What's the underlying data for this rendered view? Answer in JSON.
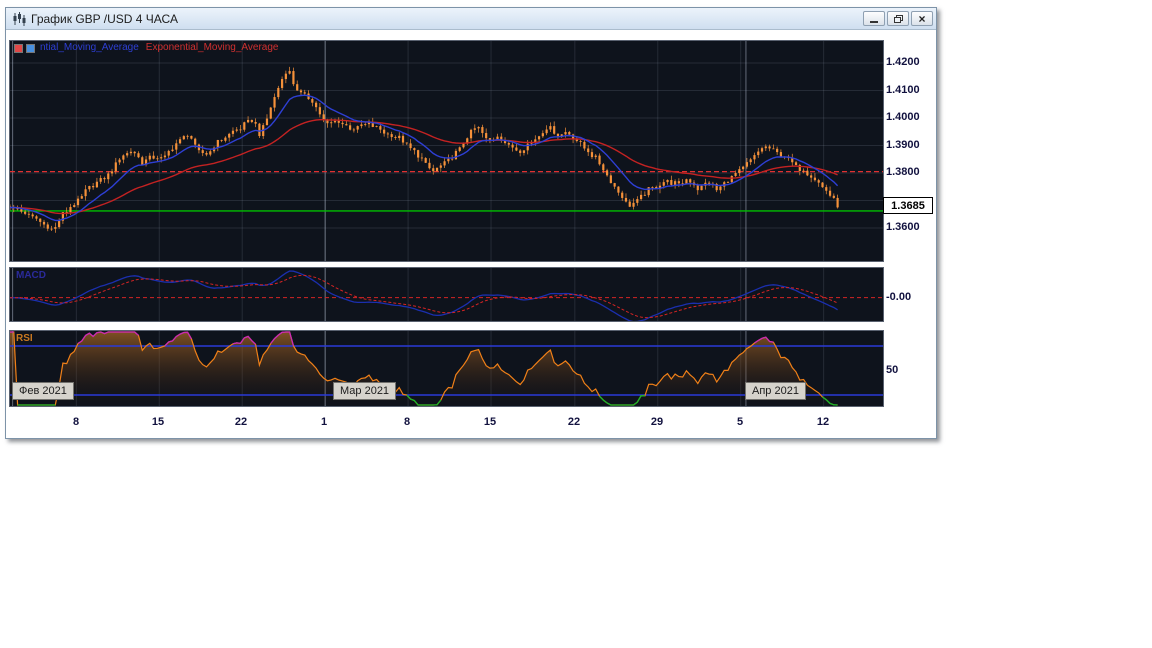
{
  "window": {
    "title": "График GBP /USD  4 ЧАСА",
    "close_glyph": "×"
  },
  "legend": {
    "blue_label": "ntial_Moving_Average",
    "red_label": "Exponential_Moving_Average"
  },
  "panels": {
    "macd_label": "MACD",
    "rsi_label": "RSI"
  },
  "price_axis": {
    "labels": [
      "1.4200",
      "1.4100",
      "1.4000",
      "1.3900",
      "1.3800",
      "1.3600"
    ],
    "current_price": "1.3685"
  },
  "macd_axis": {
    "zero_label": "-0.00"
  },
  "rsi_axis": {
    "mid_label": "50"
  },
  "time_axis": {
    "ticks": [
      "8",
      "15",
      "22",
      "1",
      "8",
      "15",
      "22",
      "29",
      "5",
      "12"
    ],
    "months": [
      "Фев 2021",
      "Мар 2021",
      "Апр 2021"
    ]
  },
  "chart_data": {
    "type": "candlestick",
    "symbol": "GBP/USD",
    "timeframe": "4 часа",
    "price_range": [
      1.348,
      1.428
    ],
    "grid_prices": [
      1.36,
      1.37,
      1.38,
      1.39,
      1.4,
      1.41,
      1.42
    ],
    "tick_fracs": [
      0.076,
      0.171,
      0.266,
      0.361,
      0.456,
      0.551,
      0.647,
      0.742,
      0.837,
      0.932
    ],
    "month_line_fracs": [
      0.003,
      0.361,
      0.843
    ],
    "data_end_frac": 0.948,
    "candle_count": 220,
    "levels": {
      "green_line": 1.3662,
      "red_dashed_line": 1.3805
    },
    "indicators": {
      "ema_fast_period": 12,
      "ema_slow_period": 40,
      "macd_fast": 12,
      "macd_slow": 26,
      "macd_signal": 9,
      "rsi_period": 14,
      "rsi_upper": 70,
      "rsi_lower": 30
    },
    "macd_zero_frac": 0.56,
    "price_path": [
      [
        0.001,
        1.368
      ],
      [
        0.026,
        1.364
      ],
      [
        0.049,
        1.359
      ],
      [
        0.061,
        1.365
      ],
      [
        0.078,
        1.37
      ],
      [
        0.095,
        1.376
      ],
      [
        0.112,
        1.379
      ],
      [
        0.127,
        1.386
      ],
      [
        0.141,
        1.388
      ],
      [
        0.152,
        1.3835
      ],
      [
        0.164,
        1.386
      ],
      [
        0.175,
        1.385
      ],
      [
        0.187,
        1.39
      ],
      [
        0.204,
        1.3945
      ],
      [
        0.215,
        1.388
      ],
      [
        0.227,
        1.3865
      ],
      [
        0.238,
        1.3915
      ],
      [
        0.255,
        1.395
      ],
      [
        0.267,
        1.397
      ],
      [
        0.278,
        1.3995
      ],
      [
        0.287,
        1.3935
      ],
      [
        0.301,
        1.406
      ],
      [
        0.313,
        1.415
      ],
      [
        0.318,
        1.4185
      ],
      [
        0.326,
        1.4115
      ],
      [
        0.336,
        1.408
      ],
      [
        0.347,
        1.406
      ],
      [
        0.363,
        1.3975
      ],
      [
        0.376,
        1.399
      ],
      [
        0.393,
        1.396
      ],
      [
        0.41,
        1.398
      ],
      [
        0.427,
        1.395
      ],
      [
        0.444,
        1.393
      ],
      [
        0.462,
        1.388
      ],
      [
        0.473,
        1.3845
      ],
      [
        0.484,
        1.38
      ],
      [
        0.502,
        1.3845
      ],
      [
        0.513,
        1.388
      ],
      [
        0.525,
        1.3935
      ],
      [
        0.536,
        1.397
      ],
      [
        0.547,
        1.3915
      ],
      [
        0.559,
        1.3935
      ],
      [
        0.57,
        1.39
      ],
      [
        0.582,
        1.388
      ],
      [
        0.599,
        1.3915
      ],
      [
        0.616,
        1.397
      ],
      [
        0.628,
        1.3935
      ],
      [
        0.639,
        1.395
      ],
      [
        0.651,
        1.3915
      ],
      [
        0.662,
        1.388
      ],
      [
        0.673,
        1.3845
      ],
      [
        0.685,
        1.379
      ],
      [
        0.696,
        1.3737
      ],
      [
        0.708,
        1.3683
      ],
      [
        0.719,
        1.3701
      ],
      [
        0.731,
        1.3737
      ],
      [
        0.742,
        1.3755
      ],
      [
        0.754,
        1.3773
      ],
      [
        0.765,
        1.3755
      ],
      [
        0.777,
        1.378
      ],
      [
        0.788,
        1.3744
      ],
      [
        0.8,
        1.3766
      ],
      [
        0.811,
        1.3737
      ],
      [
        0.822,
        1.3773
      ],
      [
        0.834,
        1.3801
      ],
      [
        0.842,
        1.3827
      ],
      [
        0.853,
        1.3863
      ],
      [
        0.865,
        1.3899
      ],
      [
        0.876,
        1.388
      ],
      [
        0.888,
        1.3863
      ],
      [
        0.899,
        1.3827
      ],
      [
        0.911,
        1.3809
      ],
      [
        0.922,
        1.378
      ],
      [
        0.933,
        1.3744
      ],
      [
        0.943,
        1.3701
      ],
      [
        0.948,
        1.3685
      ]
    ],
    "colors": {
      "panel_bg": "#0e131c",
      "candle": "#f5913a",
      "ema_fast": "#2e3fd4",
      "ema_slow": "#c32222",
      "macd_line": "#1b2fae",
      "macd_signal": "#d42424",
      "zero_line": "#d42424",
      "rsi_line": "#f08018",
      "rsi_over": "#c828b8",
      "rsi_under": "#18b428",
      "rsi_level": "#2a3ad8",
      "rsi_fill_top": "rgba(200,120,40,0.60)",
      "rsi_fill_bottom": "rgba(40,20,8,0.05)",
      "grid": "rgba(160,172,195,0.16)",
      "month_grid": "rgba(205,215,235,0.45)",
      "green_level": "#00c000",
      "red_level": "#e03030"
    }
  }
}
